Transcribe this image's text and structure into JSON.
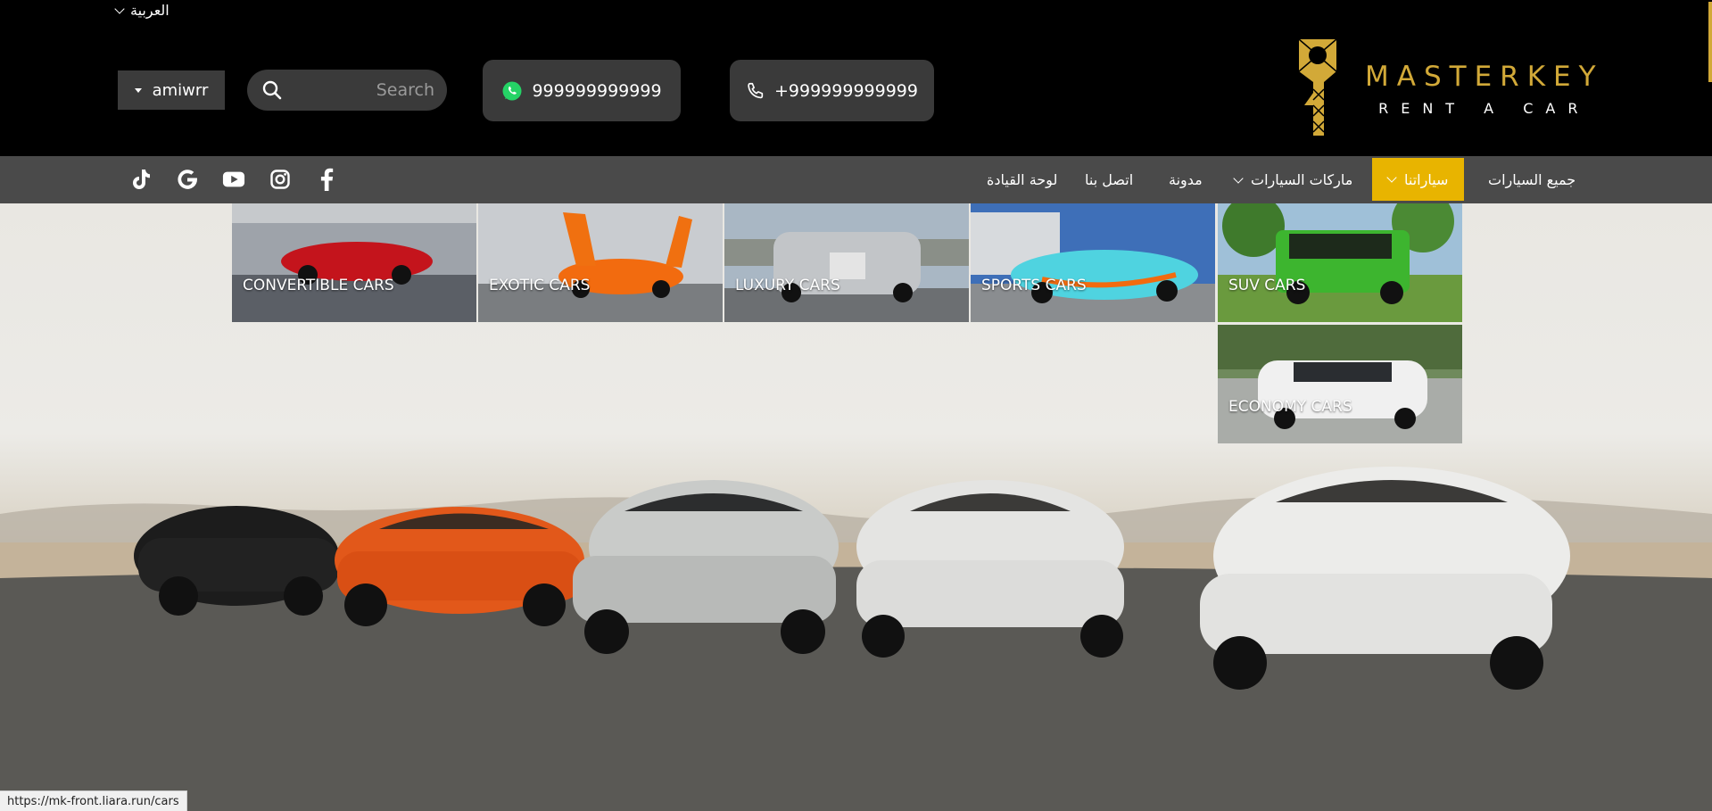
{
  "header": {
    "language": "العربية",
    "user_name": "amiwrr",
    "search_placeholder": "Search",
    "whatsapp": "999999999999",
    "phone": "+999999999999",
    "logo_main": "MASTERKEY",
    "logo_sub": "RENT A CAR"
  },
  "nav": {
    "items": [
      {
        "label": "جميع السيارات"
      },
      {
        "label": "سياراتنا"
      },
      {
        "label": "ماركات السيارات"
      },
      {
        "label": "مدونة"
      },
      {
        "label": "اتصل بنا"
      },
      {
        "label": "لوحة القيادة"
      }
    ],
    "social": [
      "facebook-icon",
      "instagram-icon",
      "youtube-icon",
      "google-icon",
      "tiktok-icon"
    ]
  },
  "dropdown": {
    "categories": [
      {
        "label": "CONVERTIBLE CARS"
      },
      {
        "label": "EXOTIC CARS"
      },
      {
        "label": "LUXURY CARS"
      },
      {
        "label": "SPORTS CARS"
      },
      {
        "label": "SUV CARS"
      },
      {
        "label": "ECONOMY CARS"
      }
    ]
  },
  "status_url": "https://mk-front.liara.run/cars",
  "colors": {
    "accent": "#e8b400",
    "gold": "#d2a938",
    "nav_bg": "#4a4a4a"
  }
}
